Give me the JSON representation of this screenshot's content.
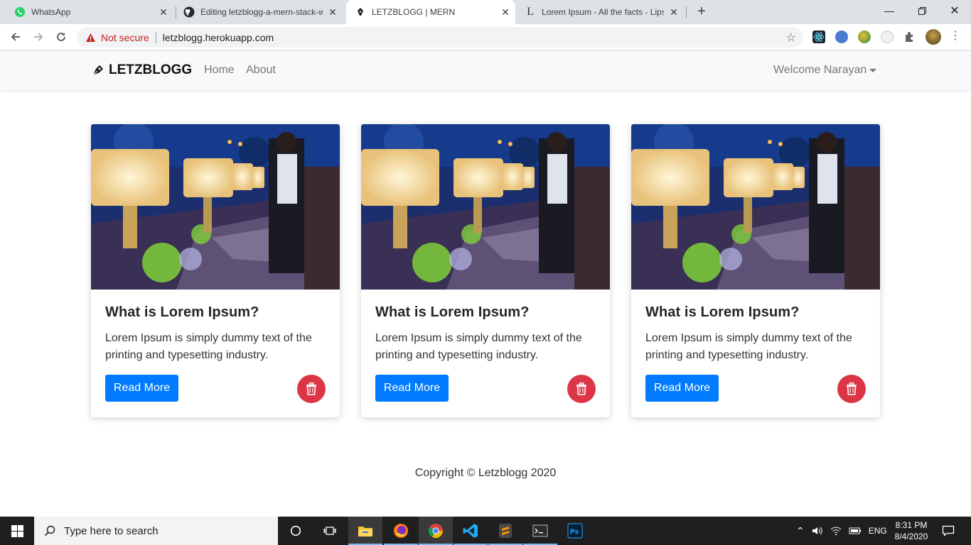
{
  "browser": {
    "tabs": [
      {
        "title": "WhatsApp",
        "active": false
      },
      {
        "title": "Editing letzblogg-a-mern-stack-w",
        "active": false
      },
      {
        "title": "LETZBLOGG | MERN",
        "active": true
      },
      {
        "title": "Lorem Ipsum - All the facts - Lips",
        "active": false
      }
    ],
    "security_label": "Not secure",
    "url": "letzblogg.herokuapp.com"
  },
  "navbar": {
    "brand": "LETZBLOGG",
    "links": [
      "Home",
      "About"
    ],
    "welcome": "Welcome Narayan"
  },
  "cards": [
    {
      "title": "What is Lorem Ipsum?",
      "text": "Lorem Ipsum is simply dummy text of the printing and typesetting industry.",
      "button": "Read More"
    },
    {
      "title": "What is Lorem Ipsum?",
      "text": "Lorem Ipsum is simply dummy text of the printing and typesetting industry.",
      "button": "Read More"
    },
    {
      "title": "What is Lorem Ipsum?",
      "text": "Lorem Ipsum is simply dummy text of the printing and typesetting industry.",
      "button": "Read More"
    }
  ],
  "footer": "Copyright © Letzblogg 2020",
  "taskbar": {
    "search_placeholder": "Type here to search",
    "language": "ENG",
    "time": "8:31 PM",
    "date": "8/4/2020"
  },
  "colors": {
    "primary": "#007bff",
    "danger": "#dc3545",
    "navbar_bg": "#f8f9fa"
  }
}
